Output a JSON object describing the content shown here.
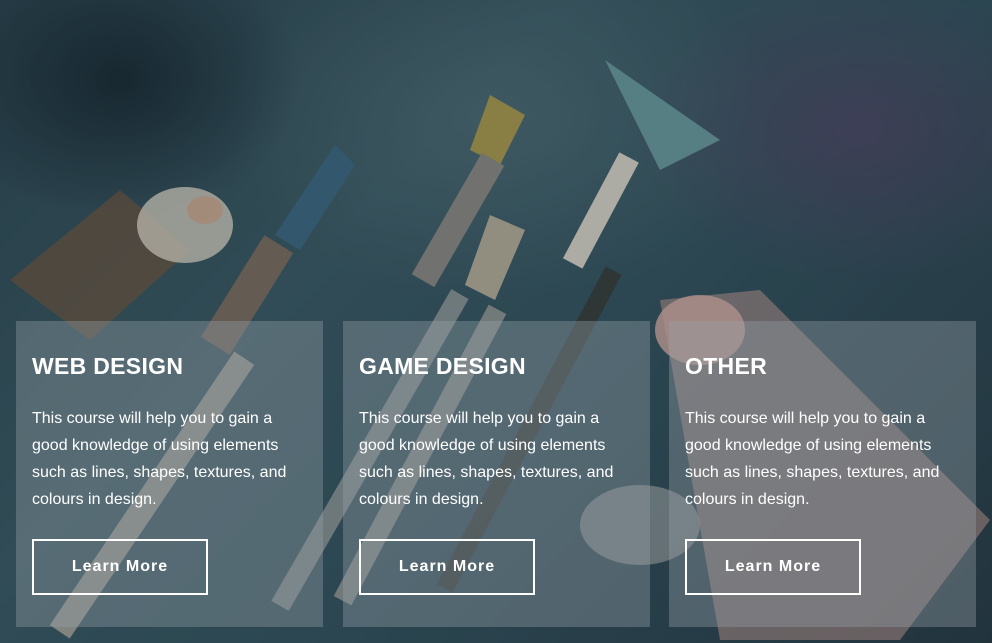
{
  "courses": [
    {
      "title": "WEB DESIGN",
      "description": "This course will help you to gain a good knowledge of using elements such as lines, shapes,  textures, and colours in design.",
      "button_label": "Learn More"
    },
    {
      "title": "GAME DESIGN",
      "description": "This course will help you to gain a good knowledge of using elements such as lines, shapes,  textures, and colours in design.",
      "button_label": "Learn More"
    },
    {
      "title": "OTHER",
      "description": "This course will help you to gain a good knowledge of using elements such as lines, shapes,  textures, and colours in design.",
      "button_label": "Learn More"
    }
  ],
  "colors": {
    "card_overlay": "#96a0a8",
    "text": "#ffffff",
    "background": "#355663"
  },
  "background_image": "paint-brushes-and-paint-tubes-photo"
}
